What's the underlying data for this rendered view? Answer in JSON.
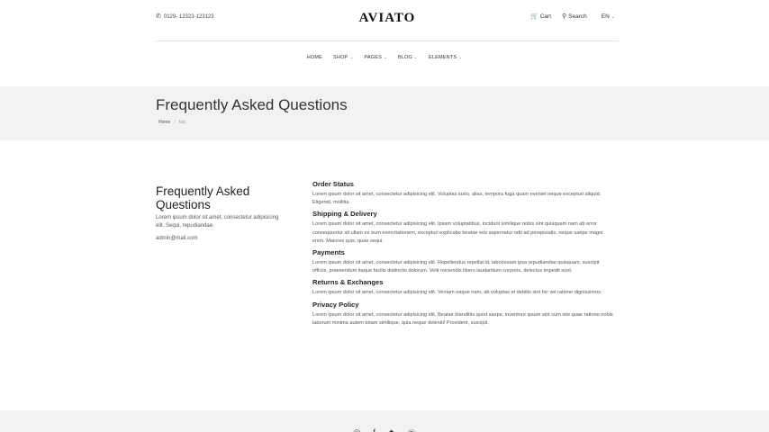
{
  "header": {
    "phone": "0129- 12323-123123",
    "logo": "AVIATO",
    "cart_label": "Cart",
    "search_label": "Search",
    "language": "EN"
  },
  "nav": {
    "items": [
      {
        "label": "HOME"
      },
      {
        "label": "SHOP"
      },
      {
        "label": "PAGES"
      },
      {
        "label": "BLOG"
      },
      {
        "label": "ELEMENTS"
      }
    ]
  },
  "hero": {
    "title": "Frequently Asked Questions",
    "breadcrumb": {
      "home": "Home",
      "separator": "/",
      "current": "faq"
    }
  },
  "aside": {
    "title": "Frequently Asked Questions",
    "text": "Lorem ipsum dolor sit amet, consectetur adipisicing elit. Sequi, repudiandae.",
    "email": "admin@mail.com"
  },
  "faq": [
    {
      "question": "Order Status",
      "answer": "Lorem ipsum dolor sit amet, consectetur adipisicing elit. Voluptas iusto, alias, tempora fuga quam eveniet neque excepturi aliquid. Eligendi, mollitia."
    },
    {
      "question": "Shipping & Delivery",
      "answer": "Lorem ipsum dolor sit amet, consectetur adipisicing elit. Ipsam voluptatibus, incidunt similique nobis sint quisquam nam ab error consequuntur sit ullam ex eum exercitationem, excepturi explicabo beatae eos aspernatur odit ad perspiciatis, neque saepe magni enim. Maiores quis, quae sequi."
    },
    {
      "question": "Payments",
      "answer": "Lorem ipsum dolor sit amet, consectetur adipisicing elit. Repellendus repellat id, laboriosam ipsa repudiandae quisquam, suscipit officiis, praesentium itaque facilis distinctio dolorum. Velit reiciendis libero laudantium corporis, delectus impedit sunt."
    },
    {
      "question": "Returns & Exchanges",
      "answer": "Lorem ipsum dolor sit amet, consectetur adipisicing elit. Veniam eaque nam, ab voluptas et debitis sint hic vel ratione dignissimos."
    },
    {
      "question": "Privacy Policy",
      "answer": "Lorem ipsum dolor sit amet, consectetur adipisicing elit. Beatae blanditiis quod saepe, inventore ipsum sint cum iste quae ratione nobis laborum minima autem totam similique, quia neque deleniti! Provident, suscipit."
    }
  ],
  "footer": {
    "social_icons": [
      "instagram-icon",
      "facebook-icon",
      "twitter-icon",
      "pinterest-icon"
    ]
  }
}
